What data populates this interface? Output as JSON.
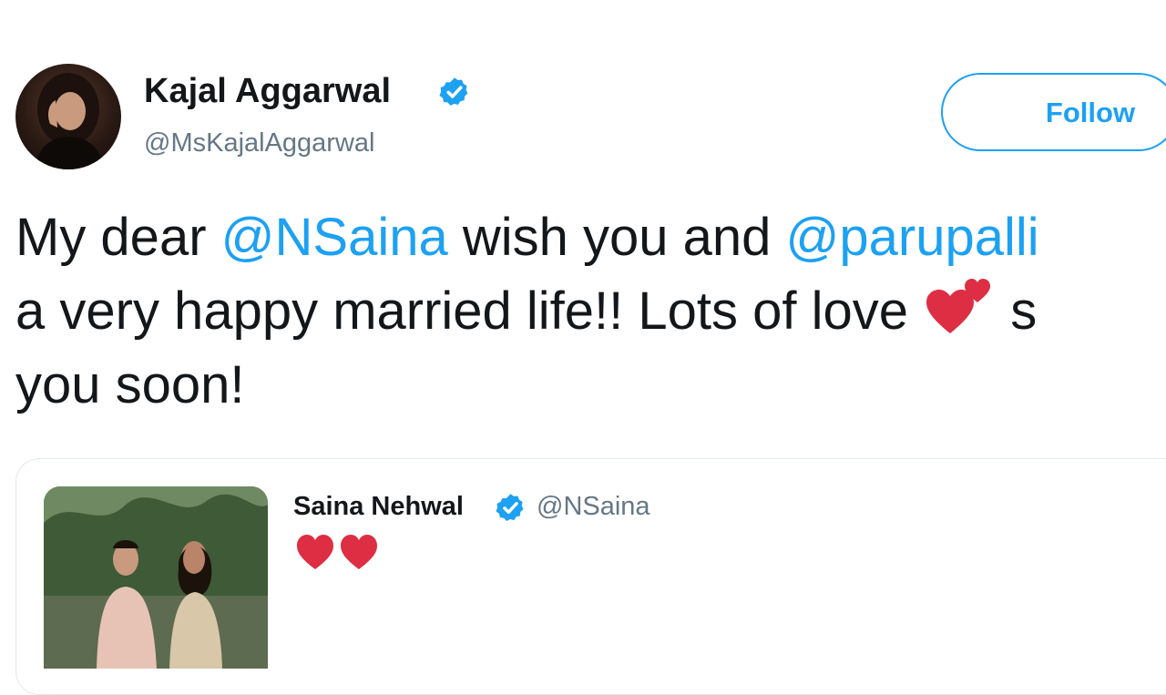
{
  "author": {
    "name": "Kajal Aggarwal",
    "handle": "@MsKajalAggarwal",
    "verified": true,
    "avatar_icon": "profile-photo"
  },
  "follow_button": {
    "label": "Follow"
  },
  "tweet": {
    "line1": {
      "pre": "My dear ",
      "mention1": "@NSaina",
      "mid": " wish you and ",
      "mention2": "@parupalli"
    },
    "line2": {
      "text": "a very happy married life!! Lots of love ",
      "emoji": "two-hearts-emoji",
      "post": " s"
    },
    "line3": {
      "text": "you soon!"
    }
  },
  "quoted_tweet": {
    "name": "Saina Nehwal",
    "handle": "@NSaina",
    "verified": true,
    "emoji": "two-red-hearts-emoji",
    "photo": "couple-photo"
  },
  "colors": {
    "accent": "#1da1f2",
    "text": "#14171a",
    "secondary_text": "#657786",
    "heart": "#e0245e",
    "border": "#e1e8ed"
  }
}
